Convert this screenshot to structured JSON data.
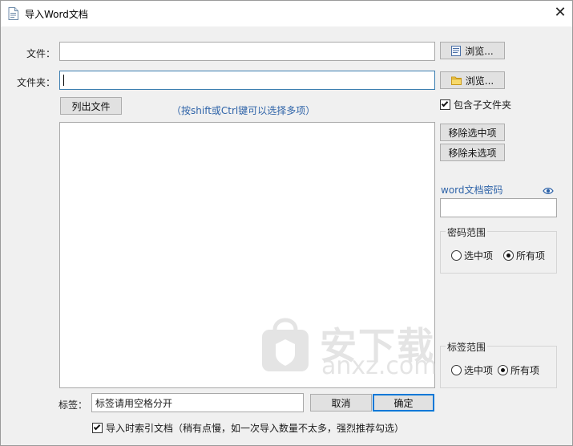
{
  "window": {
    "title": "导入Word文档",
    "close_glyph": "✕",
    "icon": "document-icon"
  },
  "file_row": {
    "label": "文件：",
    "value": "",
    "browse_label": "浏览...",
    "browse_icon": "word-file-icon"
  },
  "folder_row": {
    "label": "文件夹：",
    "value": "",
    "browse_label": "浏览...",
    "browse_icon": "folder-icon"
  },
  "list_files_button": "列出文件",
  "hint": "（按shift或Ctrl键可以选择多项）",
  "include_subfolders": {
    "label": "包含子文件夹",
    "checked": true
  },
  "remove_selected_button": "移除选中项",
  "remove_unselected_button": "移除未选项",
  "password": {
    "label": "word文档密码",
    "value": "",
    "toggle_icon": "eye-icon"
  },
  "password_scope": {
    "legend": "密码范围",
    "options": [
      "选中项",
      "所有项"
    ],
    "selected": "所有项"
  },
  "tag_scope": {
    "legend": "标签范围",
    "options": [
      "选中项",
      "所有项"
    ],
    "selected": "所有项"
  },
  "tags": {
    "label": "标签：",
    "value": "标签请用空格分开"
  },
  "cancel_button": "取消",
  "ok_button": "确定",
  "index_on_import": {
    "label": "导入时索引文档（稍有点慢，如一次导入数量不太多，强烈推荐勾选）",
    "checked": true
  },
  "watermark": {
    "brand": "安下载",
    "url": "anxz.com"
  },
  "colors": {
    "link_blue": "#2e63a8",
    "focus_border": "#3c7fb1",
    "primary_border": "#0078d7"
  }
}
